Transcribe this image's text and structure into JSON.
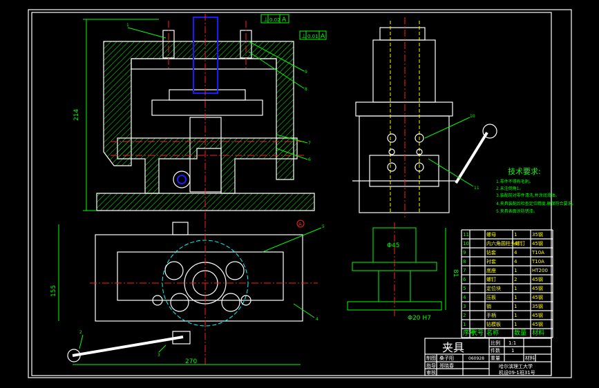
{
  "drawing": {
    "dimensions": {
      "height_front": "214",
      "depth_top": "155",
      "width_top": "270",
      "side_dia_top": "Φ45",
      "side_dia_bottom": "Φ20 H7",
      "side_height": "81"
    },
    "tolerances": [
      {
        "symbol": "⊥",
        "value": "0.02",
        "datum": "A"
      },
      {
        "symbol": "⊥",
        "value": "0.01",
        "datum": "A"
      }
    ],
    "datum_label": "A",
    "balloons": [
      "1",
      "2",
      "3",
      "4",
      "5",
      "6",
      "7",
      "8",
      "9",
      "10",
      "11"
    ]
  },
  "tech_requirements": {
    "title": "技术要求:",
    "items": [
      "1.零件不得有毛刺。",
      "2.未注倒角1。",
      "3.装配前对零件清洗,并涂润滑油。",
      "4.夹具装配后检查定位精度,确保符合要求。",
      "5.夹具表面涂防锈漆。"
    ]
  },
  "parts_list": {
    "header": [
      "序号",
      "代号",
      "名称",
      "数量",
      "材料"
    ],
    "rows": [
      [
        "11",
        "",
        "螺母",
        "1",
        "35钢"
      ],
      [
        "10",
        "",
        "内六角圆柱头螺钉",
        "4",
        "45钢"
      ],
      [
        "9",
        "",
        "钻套",
        "4",
        "T10A"
      ],
      [
        "8",
        "",
        "衬套",
        "4",
        "T10A"
      ],
      [
        "7",
        "",
        "底座",
        "1",
        "HT200"
      ],
      [
        "6",
        "",
        "螺钉",
        "2",
        "45钢"
      ],
      [
        "5",
        "",
        "定位块",
        "1",
        "45钢"
      ],
      [
        "4",
        "",
        "压板",
        "1",
        "45钢"
      ],
      [
        "3",
        "",
        "销",
        "1",
        "35钢"
      ],
      [
        "2",
        "",
        "手柄",
        "1",
        "45钢"
      ],
      [
        "1",
        "",
        "钻模板",
        "1",
        "45钢"
      ]
    ]
  },
  "title_block": {
    "title": "夹具",
    "scale_label": "比例",
    "scale": "1:1",
    "count_label": "件数",
    "count": "1",
    "drawn_label": "制图",
    "drawn_by": "桑子阳",
    "drawn_id": "060928",
    "weight_label": "重量",
    "material_label": "材料",
    "checked_label": "指导",
    "checked_by": "郑晓春",
    "approved_label": "审核",
    "school": "哈尔滨理工大学",
    "class": "机设09-1班31号"
  },
  "colors": {
    "background": "#000000",
    "outline": "#ffffff",
    "dimension": "#00ff00",
    "center": "#ff2020",
    "hidden": "#ffff00",
    "part": "#1a1aff"
  }
}
